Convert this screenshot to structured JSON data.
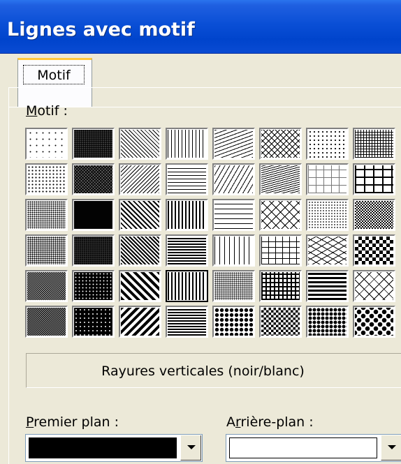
{
  "window": {
    "title": "Lignes avec motif"
  },
  "tabs": [
    {
      "label": "Motif",
      "active": true
    }
  ],
  "pattern_section": {
    "label_mnemonic": "M",
    "label_rest": "otif :",
    "selected_index": 35,
    "patterns": [
      "dots-sparse",
      "dots-dense-dark",
      "diag-down-fine",
      "vert-fine",
      "wave-horiz",
      "zigzag",
      "dots-diag",
      "grid-fine",
      "dots-medium",
      "checker-dark",
      "diag-up-fine",
      "horiz-fine",
      "diag-up-dashed",
      "wave-dense",
      "grid-dotted",
      "grid-wide",
      "dots-tiny-dense",
      "solid-dark-grain",
      "diag-down-wide",
      "vert-wide",
      "horiz-dashed",
      "diag-brick",
      "grid-dotted-fine",
      "checker-fine",
      "dots-dense",
      "dots-big-dark",
      "diag-down-bold",
      "horiz-medium",
      "vert-dashed",
      "brick",
      "weave",
      "checker-large",
      "checker-fine-dark",
      "dots-white-on-black",
      "diag-down-thick",
      "vert-thick",
      "confetti",
      "plaid",
      "horiz-thick",
      "diamond-outline",
      "checker-medium",
      "dots-white-sparse",
      "diag-up-thick",
      "horiz-bold",
      "sphere",
      "trellis",
      "shingle",
      "diamond-solid"
    ]
  },
  "pattern_name": "Rayures verticales (noir/blanc)",
  "foreground": {
    "label_mnemonic": "P",
    "label_rest": "remier plan :",
    "color": "#000000"
  },
  "background": {
    "label_pre": "A",
    "label_mnemonic": "r",
    "label_rest": "rière-plan :",
    "color": "#ffffff"
  }
}
